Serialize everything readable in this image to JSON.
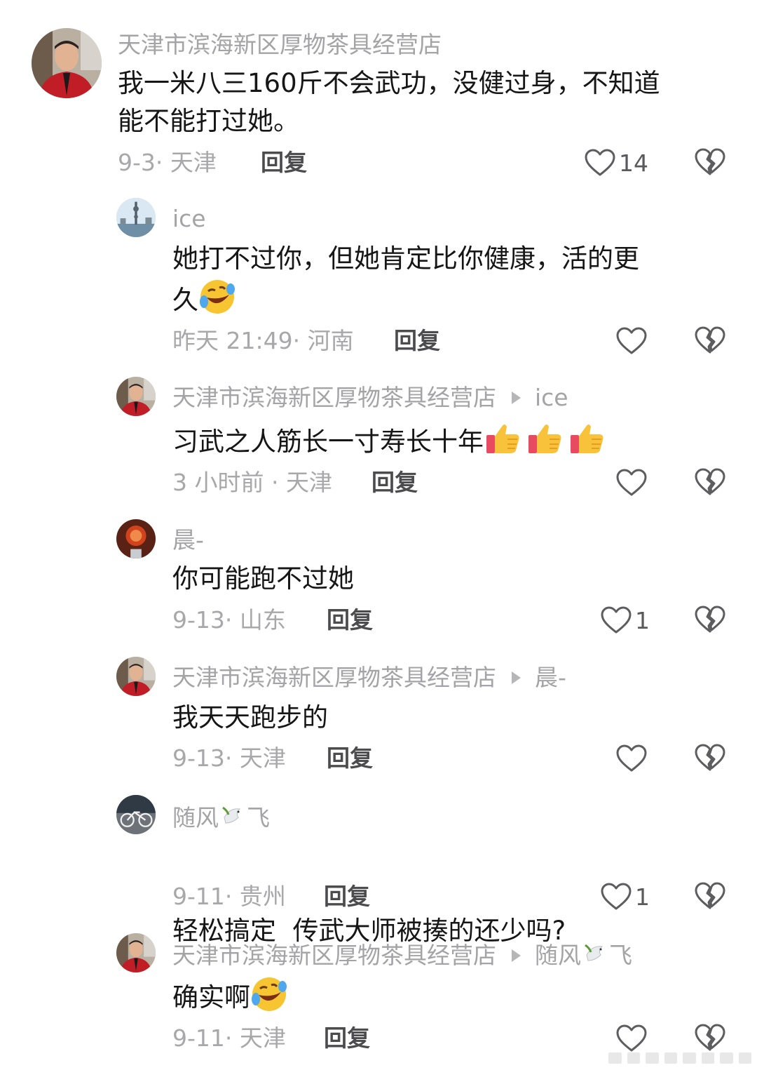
{
  "comments": [
    {
      "user": "天津市滨海新区厚物茶具经营店",
      "reply_to": "",
      "text_line1": "我一米八三160斤不会武功，没健过身，不知道",
      "text_line2": "能不能打过她。",
      "meta": "9-3· 天津",
      "reply_label": "回复",
      "likes": "14"
    },
    {
      "user": "ice",
      "reply_to": "",
      "text_line1": "她打不过你，但她肯定比你健康，活的更",
      "text_line2": "久",
      "emoji": "rofl-emoji",
      "meta": "昨天 21:49· 河南",
      "reply_label": "回复",
      "likes": ""
    },
    {
      "user": "天津市滨海新区厚物茶具经营店",
      "reply_to": "ice",
      "text_line1": "习武之人筋长一寸寿长十年",
      "emoji": "thumbs-up-emoji x3",
      "meta": "3 小时前 · 天津",
      "reply_label": "回复",
      "likes": ""
    },
    {
      "user": "晨-",
      "reply_to": "",
      "text_line1": "你可能跑不过她",
      "meta": "9-13· 山东",
      "reply_label": "回复",
      "likes": "1"
    },
    {
      "user": "天津市滨海新区厚物茶具经营店",
      "reply_to": "晨-",
      "text_line1": "我天天跑步的",
      "meta": "9-13· 天津",
      "reply_label": "回复",
      "likes": ""
    },
    {
      "user_prefix": "随风",
      "user_suffix": "飞",
      "reply_to": "",
      "text_line1": "轻松搞定  传武大师被揍的还少吗?",
      "meta": "9-11· 贵州",
      "reply_label": "回复",
      "likes": "1"
    },
    {
      "user": "天津市滨海新区厚物茶具经营店",
      "reply_to_prefix": "随风",
      "reply_to_suffix": "飞",
      "text_line1": "确实啊",
      "meta": "9-11· 天津",
      "reply_label": "回复",
      "likes": ""
    }
  ],
  "icons": {
    "like": "heart-outline-icon",
    "dislike": "broken-heart-icon",
    "reply_arrow": "play-arrow-icon",
    "dove": "dove-emoji"
  },
  "colors": {
    "username": "#a4a4a7",
    "text": "#161616",
    "meta": "#a8a8ab",
    "reply": "#4c4c4e"
  }
}
